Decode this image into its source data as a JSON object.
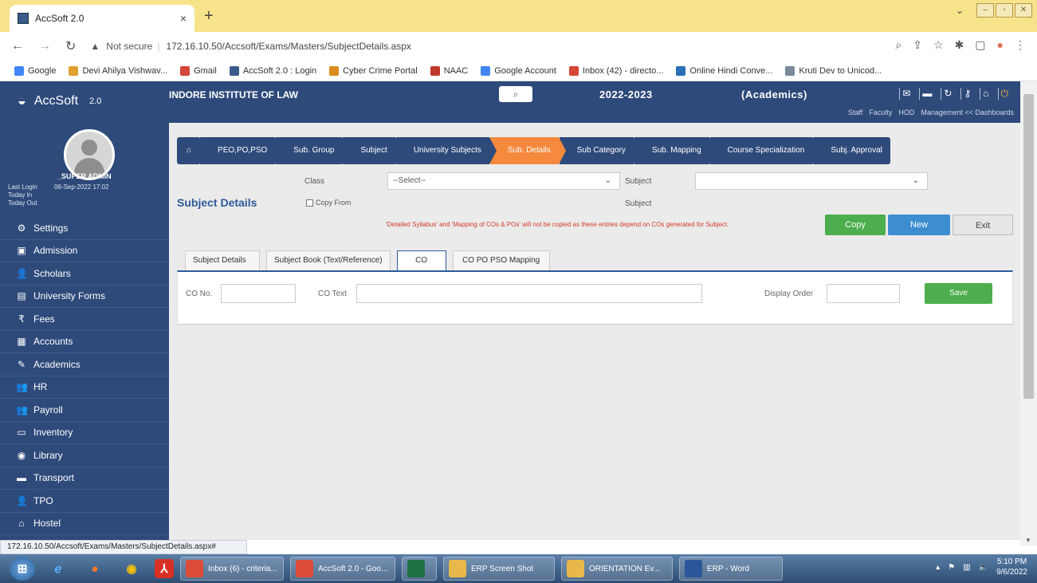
{
  "browser": {
    "tab_title": "AccSoft 2.0",
    "tab_close": "×",
    "new_tab": "+",
    "not_secure": "Not secure",
    "url": "172.16.10.50/Accsoft/Exams/Masters/SubjectDetails.aspx",
    "bookmarks": [
      {
        "label": "Google",
        "color": "#4285f4"
      },
      {
        "label": "Devi Ahilya Vishwav...",
        "color": "#e0a030"
      },
      {
        "label": "Gmail",
        "color": "#d44638"
      },
      {
        "label": "AccSoft 2.0 : Login",
        "color": "#3a5a8c"
      },
      {
        "label": "Cyber Crime Portal",
        "color": "#d98c1a"
      },
      {
        "label": "NAAC",
        "color": "#c0392b"
      },
      {
        "label": "Google Account",
        "color": "#4285f4"
      },
      {
        "label": "Inbox (42) - directo...",
        "color": "#d44638"
      },
      {
        "label": "Online Hindi Conve...",
        "color": "#2a6fb8"
      },
      {
        "label": "Kruti Dev to Unicod...",
        "color": "#7a8a9a"
      }
    ],
    "status_url": "172.16.10.50/Accsoft/Exams/Masters/SubjectDetails.aspx#"
  },
  "header": {
    "app_name": "AccSoft",
    "app_version": "2.0",
    "institute": "INDORE INSTITUTE OF LAW",
    "session": "2022-2023",
    "module": "(Academics)",
    "roles": [
      "Staff",
      "Faculty",
      "HOD",
      "Management << Dashboards"
    ]
  },
  "sidebar": {
    "user_name": "_SUPER ADMIN",
    "last_login_label": "Last Login",
    "last_login_value": "06-Sep-2022 17:02",
    "today_in_label": "Today In",
    "today_out_label": "Today Out",
    "items": [
      {
        "label": "Settings",
        "icon": "gear-icon",
        "glyph": "⚙"
      },
      {
        "label": "Admission",
        "icon": "admission-icon",
        "glyph": "▣"
      },
      {
        "label": "Scholars",
        "icon": "user-icon",
        "glyph": "👤"
      },
      {
        "label": "University Forms",
        "icon": "forms-icon",
        "glyph": "▤"
      },
      {
        "label": "Fees",
        "icon": "rupee-icon",
        "glyph": "₹"
      },
      {
        "label": "Accounts",
        "icon": "calculator-icon",
        "glyph": "▦"
      },
      {
        "label": "Academics",
        "icon": "pencil-icon",
        "glyph": "✎"
      },
      {
        "label": "HR",
        "icon": "users-icon",
        "glyph": "👥"
      },
      {
        "label": "Payroll",
        "icon": "payroll-icon",
        "glyph": "👥"
      },
      {
        "label": "Inventory",
        "icon": "inventory-icon",
        "glyph": "▭"
      },
      {
        "label": "Library",
        "icon": "library-icon",
        "glyph": "◉"
      },
      {
        "label": "Transport",
        "icon": "car-icon",
        "glyph": "▬"
      },
      {
        "label": "TPO",
        "icon": "tpo-icon",
        "glyph": "👤"
      },
      {
        "label": "Hostel",
        "icon": "home-icon",
        "glyph": "⌂"
      }
    ]
  },
  "wizard": [
    {
      "label": "⌂",
      "active": false
    },
    {
      "label": "PEO,PO,PSO",
      "active": false
    },
    {
      "label": "Sub. Group",
      "active": false
    },
    {
      "label": "Subject",
      "active": false
    },
    {
      "label": "University Subjects",
      "active": false
    },
    {
      "label": "Sub. Details",
      "active": true
    },
    {
      "label": "Sub Category",
      "active": false
    },
    {
      "label": "Sub. Mapping",
      "active": false
    },
    {
      "label": "Course Specialization",
      "active": false
    },
    {
      "label": "Subj. Approval",
      "active": false
    }
  ],
  "form": {
    "class_label": "Class",
    "class_value": "--Select--",
    "subject_label": "Subject",
    "subject_value": "",
    "subject_label2": "Subject",
    "page_title": "Subject Details",
    "copy_from_label": "Copy From",
    "note": "'Detailed Syllabus' and 'Mapping of COs & POs' will not be copied as these entries depend on COs generated for Subject.",
    "copy_button": "Copy",
    "new_button": "New",
    "exit_button": "Exit"
  },
  "tabs": [
    {
      "label": "Subject Details",
      "active": false
    },
    {
      "label": "Subject Book (Text/Reference)",
      "active": false
    },
    {
      "label": "CO",
      "active": true
    },
    {
      "label": "CO PO PSO Mapping",
      "active": false
    }
  ],
  "co_form": {
    "co_no_label": "CO No.",
    "co_text_label": "CO Text",
    "display_order_label": "Display Order",
    "save_button": "Save"
  },
  "taskbar": {
    "apps": [
      {
        "label": "Inbox (6) - criteria...",
        "color": "#dd4b39"
      },
      {
        "label": "AccSoft 2.0 - Goo...",
        "color": "#dd4b39"
      },
      {
        "label": "",
        "color": "#1f7244"
      },
      {
        "label": "ERP Screen Shot",
        "color": "#e8b84a"
      },
      {
        "label": "ORIENTATION Ev...",
        "color": "#e8b84a"
      },
      {
        "label": "ERP - Word",
        "color": "#2b579a"
      }
    ],
    "time": "5:10 PM",
    "date": "9/6/2022"
  }
}
